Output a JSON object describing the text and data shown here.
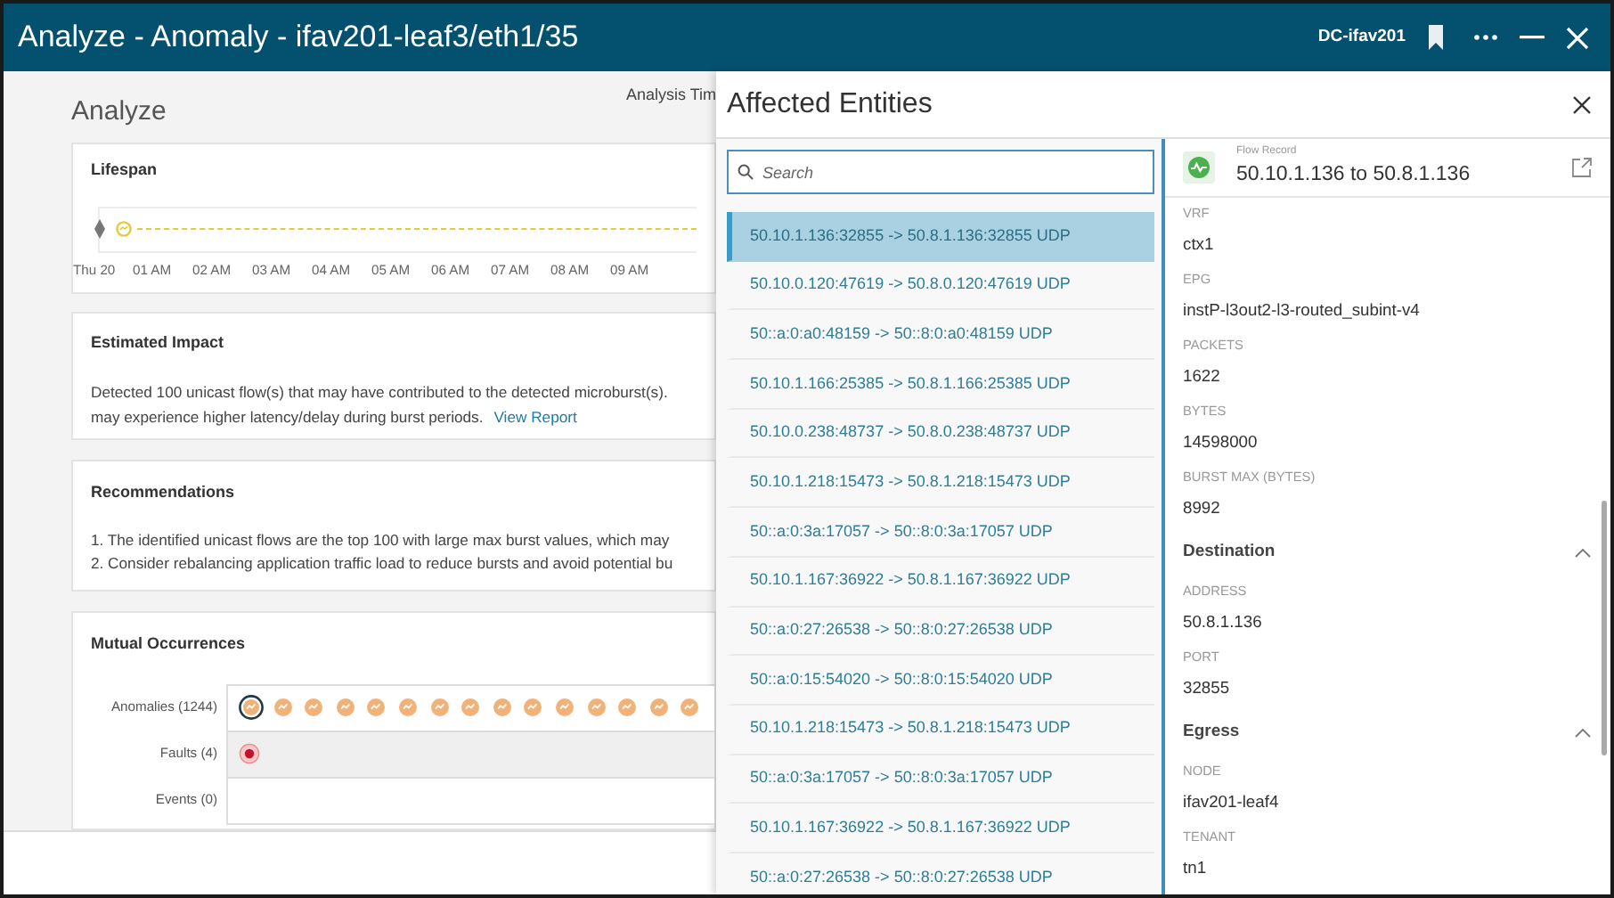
{
  "window": {
    "title": "Analyze - Anomaly - ifav201-leaf3/eth1/35",
    "context": "DC-ifav201"
  },
  "page": {
    "heading": "Analyze",
    "analysis_time_label": "Analysis Tim"
  },
  "lifespan": {
    "title": "Lifespan",
    "axis_labels": [
      "Thu 20",
      "01 AM",
      "02 AM",
      "03 AM",
      "04 AM",
      "05 AM",
      "06 AM",
      "07 AM",
      "08 AM",
      "09 AM"
    ]
  },
  "estimated_impact": {
    "title": "Estimated Impact",
    "lines": [
      "Detected 100 unicast flow(s) that may have contributed to the detected microburst(s).",
      "may experience higher latency/delay during burst periods."
    ],
    "link": "View Report"
  },
  "recommendations": {
    "title": "Recommendations",
    "items": [
      "1. The identified unicast flows are the top 100 with large max burst values, which may",
      "2. Consider rebalancing application traffic load to reduce bursts and avoid potential bu"
    ]
  },
  "mutual_occurrences": {
    "title": "Mutual Occurrences",
    "rows": [
      {
        "label": "Anomalies (1244)",
        "kind": "anomalies"
      },
      {
        "label": "Faults (4)",
        "kind": "faults"
      },
      {
        "label": "Events (0)",
        "kind": "events"
      }
    ]
  },
  "drawer": {
    "title": "Affected Entities",
    "search": {
      "placeholder": "Search"
    },
    "flows": [
      {
        "label": "50.10.1.136:32855 -> 50.8.1.136:32855 UDP",
        "selected": true
      },
      {
        "label": "50.10.0.120:47619 -> 50.8.0.120:47619 UDP",
        "selected": false
      },
      {
        "label": "50::a:0:a0:48159 -> 50::8:0:a0:48159 UDP",
        "selected": false
      },
      {
        "label": "50.10.1.166:25385 -> 50.8.1.166:25385 UDP",
        "selected": false
      },
      {
        "label": "50.10.0.238:48737 -> 50.8.0.238:48737 UDP",
        "selected": false
      },
      {
        "label": "50.10.1.218:15473 -> 50.8.1.218:15473 UDP",
        "selected": false
      },
      {
        "label": "50::a:0:3a:17057 -> 50::8:0:3a:17057 UDP",
        "selected": false
      },
      {
        "label": "50.10.1.167:36922 -> 50.8.1.167:36922 UDP",
        "selected": false
      },
      {
        "label": "50::a:0:27:26538 -> 50::8:0:27:26538 UDP",
        "selected": false
      },
      {
        "label": "50::a:0:15:54020 -> 50::8:0:15:54020 UDP",
        "selected": false
      },
      {
        "label": "50.10.1.218:15473 -> 50.8.1.218:15473 UDP",
        "selected": false
      },
      {
        "label": "50::a:0:3a:17057 -> 50::8:0:3a:17057 UDP",
        "selected": false
      },
      {
        "label": "50.10.1.167:36922 -> 50.8.1.167:36922 UDP",
        "selected": false
      },
      {
        "label": "50::a:0:27:26538 -> 50::8:0:27:26538 UDP",
        "selected": false
      }
    ],
    "detail": {
      "caption": "Flow Record",
      "title": "50.10.1.136 to 50.8.1.136",
      "fields": [
        {
          "label": "VRF",
          "value": "ctx1"
        },
        {
          "label": "EPG",
          "value": "instP-l3out2-l3-routed_subint-v4"
        },
        {
          "label": "PACKETS",
          "value": "1622"
        },
        {
          "label": "BYTES",
          "value": "14598000"
        },
        {
          "label": "BURST MAX (BYTES)",
          "value": "8992"
        }
      ],
      "sections": [
        {
          "title": "Destination",
          "expanded": true,
          "fields": [
            {
              "label": "ADDRESS",
              "value": "50.8.1.136"
            },
            {
              "label": "PORT",
              "value": "32855"
            }
          ]
        },
        {
          "title": "Egress",
          "expanded": true,
          "fields": [
            {
              "label": "NODE",
              "value": "ifav201-leaf4"
            },
            {
              "label": "TENANT",
              "value": "tn1"
            }
          ]
        }
      ]
    }
  }
}
